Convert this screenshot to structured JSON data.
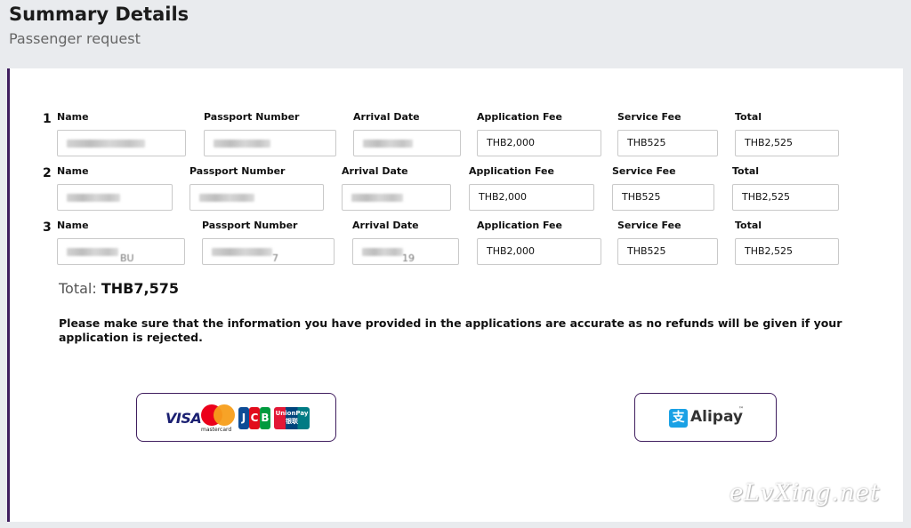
{
  "header": {
    "title": "Summary Details",
    "subtitle": "Passenger request"
  },
  "columns": {
    "name": "Name",
    "passport": "Passport Number",
    "arrival": "Arrival Date",
    "app_fee": "Application Fee",
    "service_fee": "Service Fee",
    "total": "Total"
  },
  "passengers": [
    {
      "num": "1",
      "name": "",
      "passport": "",
      "arrival": "",
      "app_fee": "THB2,000",
      "service_fee": "THB525",
      "total": "THB2,525"
    },
    {
      "num": "2",
      "name": "",
      "passport": "",
      "arrival": "",
      "app_fee": "THB2,000",
      "service_fee": "THB525",
      "total": "THB2,525"
    },
    {
      "num": "3",
      "name": "BU",
      "passport": "7",
      "arrival": "19",
      "app_fee": "THB2,000",
      "service_fee": "THB525",
      "total": "THB2,525"
    }
  ],
  "summary": {
    "total_label": "Total:",
    "total_value": "THB7,575"
  },
  "notice": "Please make sure that the information you have provided in the applications are accurate as no refunds will be given if your application is rejected.",
  "payment": {
    "card_logos": {
      "visa": "VISA",
      "mastercard": "mastercard",
      "jcb": [
        "J",
        "C",
        "B"
      ],
      "unionpay": "UnionPay 银联"
    },
    "alipay": {
      "label": "Alipay",
      "icon": "支",
      "tm": "™"
    },
    "accent_color": "#3f1d5e"
  },
  "watermark": "eLvXing.net"
}
